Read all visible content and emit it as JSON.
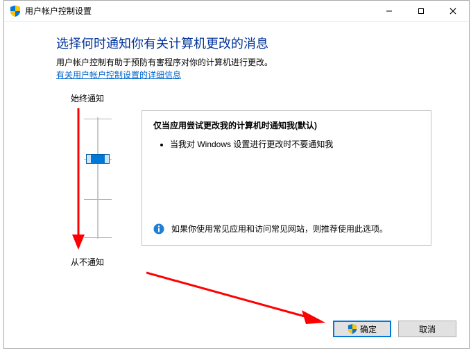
{
  "window": {
    "title": "用户帐户控制设置"
  },
  "heading": "选择何时通知你有关计算机更改的消息",
  "subtext": "用户帐户控制有助于预防有害程序对你的计算机进行更改。",
  "link": "有关用户帐户控制设置的详细信息",
  "slider": {
    "top_label": "始终通知",
    "bottom_label": "从不通知"
  },
  "panel": {
    "title": "仅当应用尝试更改我的计算机时通知我(默认)",
    "bullet1": "当我对 Windows 设置进行更改时不要通知我",
    "info": "如果你使用常见应用和访问常见网站，则推荐使用此选项。"
  },
  "buttons": {
    "ok": "确定",
    "cancel": "取消"
  }
}
